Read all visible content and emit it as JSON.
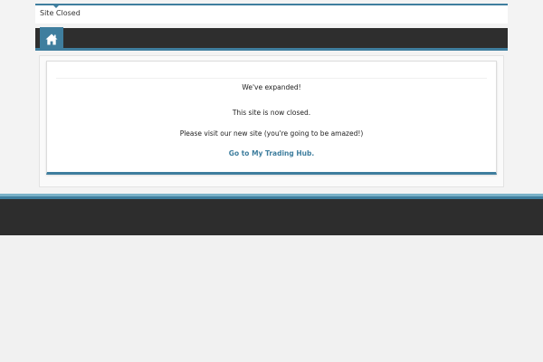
{
  "header": {
    "site_title": "Site Closed",
    "home_icon": "home-icon"
  },
  "content": {
    "line1": "We've expanded!",
    "line2": "This site is now closed.",
    "line3": "Please visit our new site (you're going to be amazed!)",
    "link_text": "Go to My Trading Hub."
  },
  "colors": {
    "accent": "#3f7e9e",
    "nav_bg": "#2e2e2e",
    "footer_bg": "#2d2d2d"
  }
}
